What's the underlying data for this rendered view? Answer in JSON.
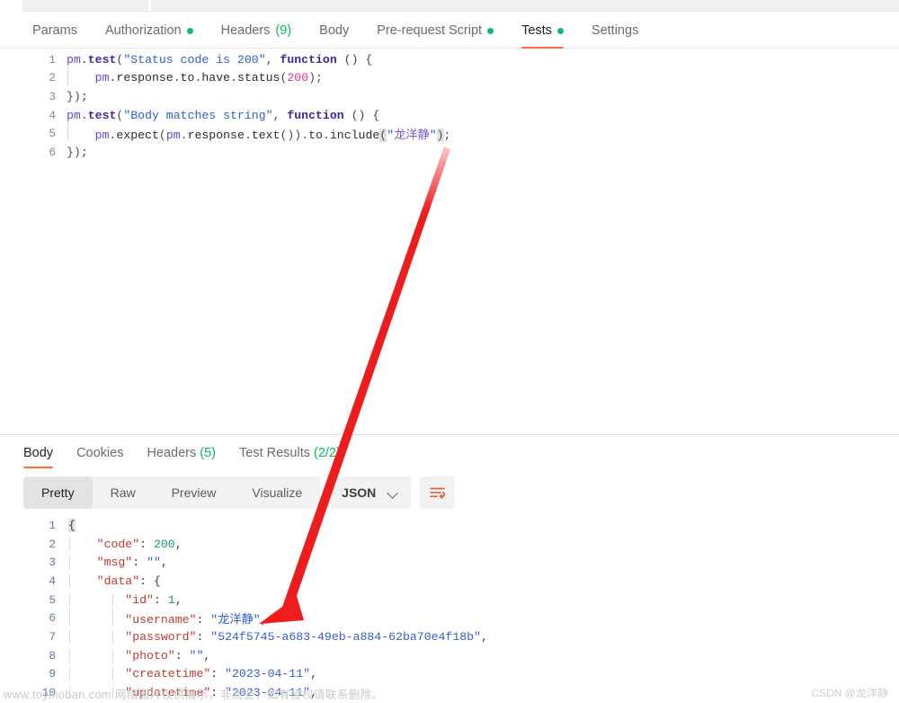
{
  "request_tabs": [
    {
      "label": "Params",
      "dot": false,
      "count": "",
      "active": false
    },
    {
      "label": "Authorization",
      "dot": true,
      "count": "",
      "active": false
    },
    {
      "label": "Headers",
      "dot": false,
      "count": "(9)",
      "active": false
    },
    {
      "label": "Body",
      "dot": false,
      "count": "",
      "active": false
    },
    {
      "label": "Pre-request Script",
      "dot": true,
      "count": "",
      "active": false
    },
    {
      "label": "Tests",
      "dot": true,
      "count": "",
      "active": true
    },
    {
      "label": "Settings",
      "dot": false,
      "count": "",
      "active": false
    }
  ],
  "editor": {
    "lines": [
      {
        "n": "1",
        "tokens": [
          {
            "t": "pm",
            "c": "k-pm"
          },
          {
            "t": ".",
            "c": "k-punc"
          },
          {
            "t": "test",
            "c": "k-fn"
          },
          {
            "t": "(",
            "c": "k-punc"
          },
          {
            "t": "\"Status code is 200\"",
            "c": "k-str"
          },
          {
            "t": ", ",
            "c": "k-punc"
          },
          {
            "t": "function",
            "c": "k-kw"
          },
          {
            "t": " () {",
            "c": "k-punc"
          }
        ]
      },
      {
        "n": "2",
        "indent": 1,
        "tokens": [
          {
            "t": "    pm",
            "c": "k-pm"
          },
          {
            "t": ".",
            "c": "k-punc"
          },
          {
            "t": "response",
            "c": "k-prop"
          },
          {
            "t": ".",
            "c": "k-punc"
          },
          {
            "t": "to",
            "c": "k-prop"
          },
          {
            "t": ".",
            "c": "k-punc"
          },
          {
            "t": "have",
            "c": "k-prop"
          },
          {
            "t": ".",
            "c": "k-punc"
          },
          {
            "t": "status",
            "c": "k-prop"
          },
          {
            "t": "(",
            "c": "k-punc"
          },
          {
            "t": "200",
            "c": "k-num"
          },
          {
            "t": ");",
            "c": "k-punc"
          }
        ]
      },
      {
        "n": "3",
        "tokens": [
          {
            "t": "});",
            "c": "k-punc"
          }
        ]
      },
      {
        "n": "4",
        "tokens": [
          {
            "t": "pm",
            "c": "k-pm"
          },
          {
            "t": ".",
            "c": "k-punc"
          },
          {
            "t": "test",
            "c": "k-fn"
          },
          {
            "t": "(",
            "c": "k-punc"
          },
          {
            "t": "\"Body matches string\"",
            "c": "k-str"
          },
          {
            "t": ", ",
            "c": "k-punc"
          },
          {
            "t": "function",
            "c": "k-kw"
          },
          {
            "t": " () {",
            "c": "k-punc"
          }
        ]
      },
      {
        "n": "5",
        "indent": 1,
        "tokens": [
          {
            "t": "    pm",
            "c": "k-pm"
          },
          {
            "t": ".",
            "c": "k-punc"
          },
          {
            "t": "expect",
            "c": "k-prop"
          },
          {
            "t": "(",
            "c": "k-punc"
          },
          {
            "t": "pm",
            "c": "k-pm"
          },
          {
            "t": ".",
            "c": "k-punc"
          },
          {
            "t": "response",
            "c": "k-prop"
          },
          {
            "t": ".",
            "c": "k-punc"
          },
          {
            "t": "text",
            "c": "k-prop"
          },
          {
            "t": "())",
            "c": "k-punc"
          },
          {
            "t": ".",
            "c": "k-punc"
          },
          {
            "t": "to",
            "c": "k-prop"
          },
          {
            "t": ".",
            "c": "k-punc"
          },
          {
            "t": "include",
            "c": "k-prop"
          },
          {
            "t": "(",
            "c": "k-punc sel"
          },
          {
            "t": "\"",
            "c": "k-str"
          },
          {
            "t": "龙洋静",
            "c": "k-cjk"
          },
          {
            "t": "\"",
            "c": "k-str"
          },
          {
            "t": ")",
            "c": "k-punc sel"
          },
          {
            "t": ";",
            "c": "k-punc"
          }
        ]
      },
      {
        "n": "6",
        "tokens": [
          {
            "t": "});",
            "c": "k-punc"
          }
        ]
      }
    ]
  },
  "response_tabs": [
    {
      "label": "Body",
      "count": "",
      "active": true
    },
    {
      "label": "Cookies",
      "count": "",
      "active": false
    },
    {
      "label": "Headers",
      "count": "(5)",
      "active": false
    },
    {
      "label": "Test Results",
      "count": "(2/2)",
      "active": false
    }
  ],
  "format_bar": {
    "segments": [
      {
        "label": "Pretty",
        "active": true
      },
      {
        "label": "Raw",
        "active": false
      },
      {
        "label": "Preview",
        "active": false
      },
      {
        "label": "Visualize",
        "active": false
      }
    ],
    "selected_format": "JSON",
    "wrap_icon": "word-wrap-icon"
  },
  "response_body": {
    "lines": [
      {
        "n": "1",
        "depth": 0,
        "tokens": [
          {
            "t": "{",
            "c": "j-brace bracehl"
          }
        ]
      },
      {
        "n": "2",
        "depth": 1,
        "tokens": [
          {
            "t": "    \"code\"",
            "c": "j-key"
          },
          {
            "t": ": ",
            "c": "j-punc"
          },
          {
            "t": "200",
            "c": "j-num"
          },
          {
            "t": ",",
            "c": "j-punc"
          }
        ]
      },
      {
        "n": "3",
        "depth": 1,
        "tokens": [
          {
            "t": "    \"msg\"",
            "c": "j-key"
          },
          {
            "t": ": ",
            "c": "j-punc"
          },
          {
            "t": "\"\"",
            "c": "j-str"
          },
          {
            "t": ",",
            "c": "j-punc"
          }
        ]
      },
      {
        "n": "4",
        "depth": 1,
        "tokens": [
          {
            "t": "    \"data\"",
            "c": "j-key"
          },
          {
            "t": ": ",
            "c": "j-punc"
          },
          {
            "t": "{",
            "c": "j-brace"
          }
        ]
      },
      {
        "n": "5",
        "depth": 2,
        "tokens": [
          {
            "t": "        \"id\"",
            "c": "j-key"
          },
          {
            "t": ": ",
            "c": "j-punc"
          },
          {
            "t": "1",
            "c": "j-num"
          },
          {
            "t": ",",
            "c": "j-punc"
          }
        ]
      },
      {
        "n": "6",
        "depth": 2,
        "tokens": [
          {
            "t": "        \"username\"",
            "c": "j-key"
          },
          {
            "t": ": ",
            "c": "j-punc"
          },
          {
            "t": "\"龙洋静\"",
            "c": "j-str"
          },
          {
            "t": ",",
            "c": "j-punc"
          }
        ]
      },
      {
        "n": "7",
        "depth": 2,
        "tokens": [
          {
            "t": "        \"password\"",
            "c": "j-key"
          },
          {
            "t": ": ",
            "c": "j-punc"
          },
          {
            "t": "\"524f5745-a683-49eb-a884-62ba70e4f18b\"",
            "c": "j-str"
          },
          {
            "t": ",",
            "c": "j-punc"
          }
        ]
      },
      {
        "n": "8",
        "depth": 2,
        "tokens": [
          {
            "t": "        \"photo\"",
            "c": "j-key"
          },
          {
            "t": ": ",
            "c": "j-punc"
          },
          {
            "t": "\"\"",
            "c": "j-str"
          },
          {
            "t": ",",
            "c": "j-punc"
          }
        ]
      },
      {
        "n": "9",
        "depth": 2,
        "tokens": [
          {
            "t": "        \"createtime\"",
            "c": "j-key"
          },
          {
            "t": ": ",
            "c": "j-punc"
          },
          {
            "t": "\"2023-04-11\"",
            "c": "j-str"
          },
          {
            "t": ",",
            "c": "j-punc"
          }
        ]
      },
      {
        "n": "10",
        "depth": 2,
        "tokens": [
          {
            "t": "        \"updatetime\"",
            "c": "j-key"
          },
          {
            "t": ": ",
            "c": "j-punc"
          },
          {
            "t": "\"2023-04-11\"",
            "c": "j-str"
          },
          {
            "t": ",",
            "c": "j-punc"
          }
        ]
      }
    ]
  },
  "watermarks": {
    "left": "www.toymoban.com 网络图片仅供展示，非商业，如有侵权请联系删除。",
    "right": "CSDN @龙洋静"
  },
  "annotation": {
    "color": "#ee1c1c",
    "from_label": "test-script-include-argument",
    "to_label": "response-username-value"
  }
}
